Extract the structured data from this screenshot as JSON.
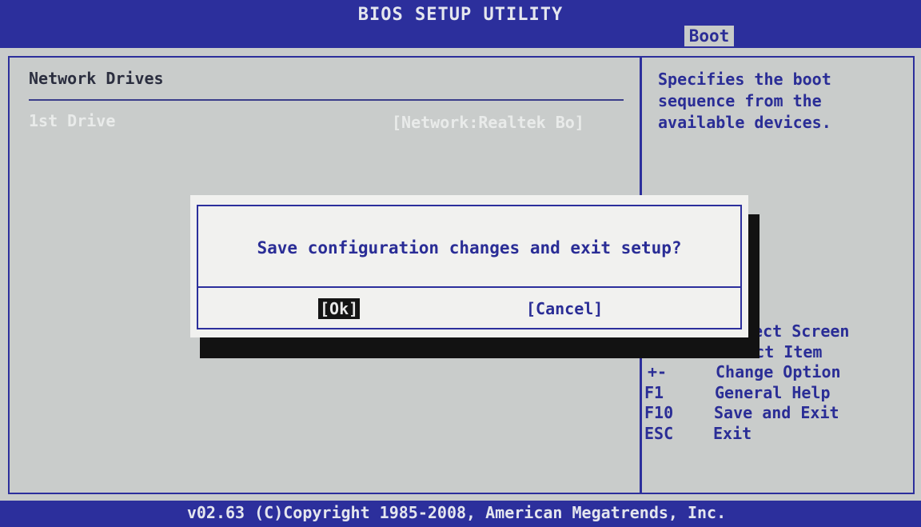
{
  "header": {
    "title": "BIOS SETUP UTILITY",
    "active_tab": "Boot"
  },
  "main": {
    "section_title": "Network Drives",
    "items": [
      {
        "label": "1st Drive",
        "value": "[Network:Realtek Bo]"
      }
    ]
  },
  "help": {
    "text": "Specifies the boot sequence from the available devices."
  },
  "keys": [
    {
      "key": "",
      "desc": "lect Screen"
    },
    {
      "key": "↑↓",
      "desc": "Select Item"
    },
    {
      "key": "+-",
      "desc": "Change Option"
    },
    {
      "key": "F1",
      "desc": "General Help"
    },
    {
      "key": "F10",
      "desc": "Save and Exit"
    },
    {
      "key": "ESC",
      "desc": "Exit"
    }
  ],
  "dialog": {
    "message": "Save configuration changes and exit setup?",
    "ok_label": "[Ok]",
    "cancel_label": "[Cancel]"
  },
  "footer": {
    "text": "v02.63 (C)Copyright 1985-2008, American Megatrends, Inc."
  },
  "colors": {
    "bios_blue": "#2c2f9c",
    "panel_gray": "#c9cccb",
    "selected_text": "#e9ebea"
  }
}
